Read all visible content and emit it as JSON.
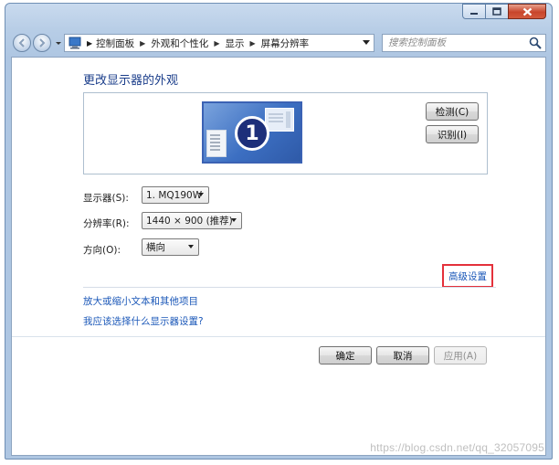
{
  "window": {
    "caption_buttons": [
      "minimize",
      "maximize",
      "close"
    ]
  },
  "nav": {
    "breadcrumb": [
      "控制面板",
      "外观和个性化",
      "显示",
      "屏幕分辨率"
    ],
    "search_placeholder": "搜索控制面板"
  },
  "main": {
    "title": "更改显示器的外观",
    "monitor_number": "1",
    "detect_label": "检测(C)",
    "identify_label": "识别(I)",
    "display_label": "显示器(S):",
    "display_value": "1. MQ190W",
    "resolution_label": "分辨率(R):",
    "resolution_value": "1440 × 900 (推荐)",
    "orientation_label": "方向(O):",
    "orientation_value": "横向",
    "advanced_link": "高级设置",
    "link_text_size": "放大或缩小文本和其他项目",
    "link_which_settings": "我应该选择什么显示器设置?"
  },
  "footer": {
    "ok_label": "确定",
    "cancel_label": "取消",
    "apply_label": "应用(A)"
  },
  "watermark": "https://blog.csdn.net/qq_32057095",
  "colors": {
    "link": "#1a57b8",
    "title": "#1a3d8a",
    "highlight_box": "#e4313b",
    "chrome": "#b7cde6"
  }
}
